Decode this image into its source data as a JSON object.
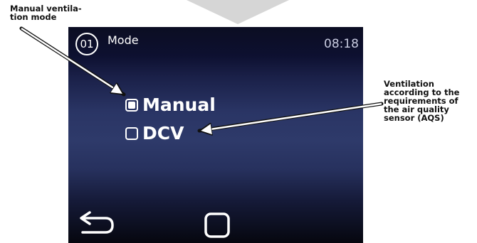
{
  "screen": {
    "badge": "01",
    "title": "Mode",
    "time": "08:18",
    "options": [
      {
        "label": "Manual",
        "checked": true
      },
      {
        "label": "DCV",
        "checked": false
      }
    ],
    "nav": {
      "back_icon": "back-arrow-icon",
      "home_icon": "square-home-icon"
    }
  },
  "annotations": {
    "left_line1": "Manual ventila-",
    "left_line2": "tion mode",
    "right_line1": "Ventilation",
    "right_line2": "according to the",
    "right_line3": "requirements of",
    "right_line4": "the air quality",
    "right_line5": "sensor (AQS)"
  }
}
